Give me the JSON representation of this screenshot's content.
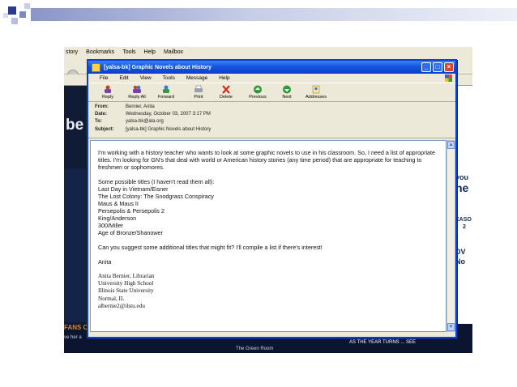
{
  "browser": {
    "menu": [
      "story",
      "Bookmarks",
      "Tools",
      "Help",
      "Mailbox"
    ],
    "be_text": "be",
    "right_texts": [
      "you",
      "ne",
      "EASO",
      "2",
      "DV",
      "No"
    ],
    "bottom_orange": "FANS C",
    "bottom_left": "ve her a",
    "bottom_center": "The Green Room",
    "bottom_mid": "DETER THE NOV/CE 24 4",
    "bottom_right": "AS THE YEAR TURNS ... SEE"
  },
  "email": {
    "title": "[yalsa-bk] Graphic Novels about History",
    "menu": [
      "File",
      "Edit",
      "View",
      "Tools",
      "Message",
      "Help"
    ],
    "toolbar": [
      {
        "label": "Reply",
        "icon": "reply-icon"
      },
      {
        "label": "Reply All",
        "icon": "reply-all-icon"
      },
      {
        "label": "Forward",
        "icon": "forward-icon"
      },
      {
        "label": "Print",
        "icon": "print-icon"
      },
      {
        "label": "Delete",
        "icon": "delete-icon"
      },
      {
        "label": "Previous",
        "icon": "previous-icon"
      },
      {
        "label": "Next",
        "icon": "next-icon"
      },
      {
        "label": "Addresses",
        "icon": "addresses-icon"
      }
    ],
    "headers": {
      "from_label": "From:",
      "from": "Bernier, Anita",
      "date_label": "Date:",
      "date": "Wednesday, October 03, 2007 3:17 PM",
      "to_label": "To:",
      "to": "yalsa-bk@ala.org",
      "subject_label": "Subject:",
      "subject": "[yalsa-bk] Graphic Novels about History"
    },
    "body": {
      "para1": "I'm working with a history teacher who wants to look at some graphic novels to use in his classroom. So, I need a list of appropriate titles. I'm looking for GN's that deal with world or American history stories (any time period) that are appropriate for teaching to freshmen or sophomores.",
      "list_intro": "Some possible titles (I haven't read them all):",
      "titles": [
        "Last Day in Vietnam/Eisner",
        "The Lost Colony: The Snodgrass Conspiracy",
        "Maus & Maus II",
        "Persepolis & Persepolis 2",
        "King/Anderson",
        "300/Miller",
        "Age of Bronze/Shanower"
      ],
      "question": "Can you suggest some additional titles that might fit? I'll compile a list if there's interest!",
      "signoff": "Anita",
      "signature": [
        "Anita Bernier, Librarian",
        "University High School",
        "Illinois State University",
        "Normal, IL",
        "albernie2@ilstu.edu"
      ]
    }
  }
}
